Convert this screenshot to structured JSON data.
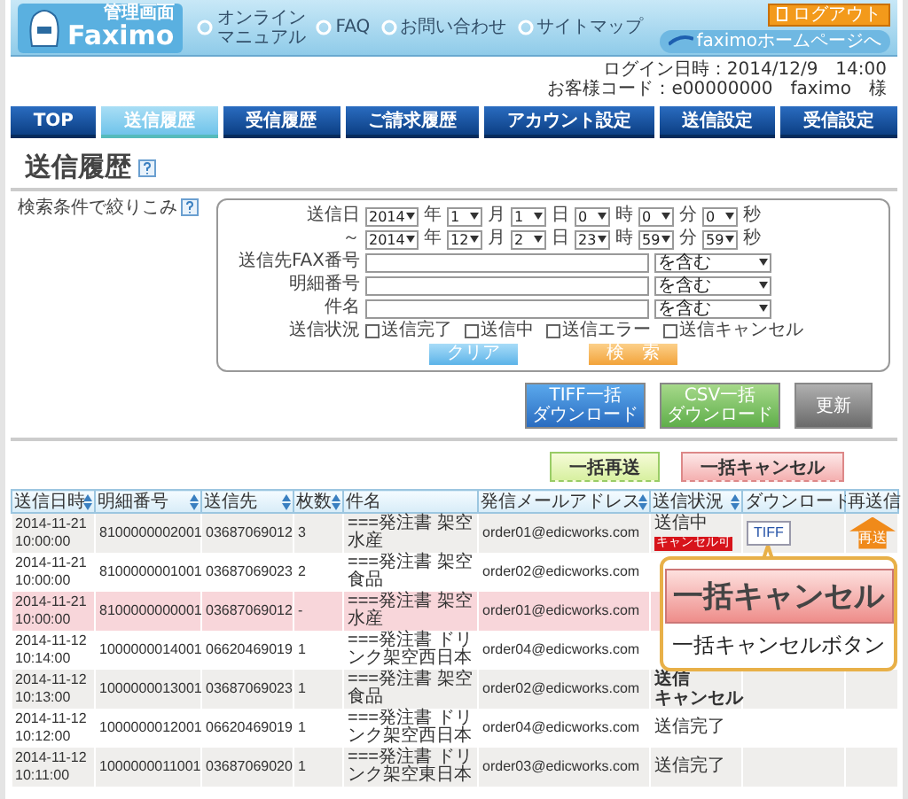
{
  "header": {
    "logo_text": "Faximo",
    "logo_caption": "管理画面",
    "links": [
      {
        "label_lines": [
          "オンライン",
          "マニュアル"
        ]
      },
      {
        "label_lines": [
          "FAQ"
        ]
      },
      {
        "label_lines": [
          "お問い合わせ"
        ]
      },
      {
        "label_lines": [
          "サイトマップ"
        ]
      }
    ],
    "homepage_link": "faximoホームページへ",
    "logout": "ログアウト"
  },
  "login": [
    "ログイン日時：2014/12/9　14:00",
    "お客様コード：e00000000　faximo　様"
  ],
  "nav": [
    {
      "label": "TOP",
      "selected": false
    },
    {
      "label": "送信履歴",
      "selected": true
    },
    {
      "label": "受信履歴",
      "selected": false
    },
    {
      "label": "ご請求履歴",
      "selected": false
    },
    {
      "label": "アカウント設定",
      "selected": false
    },
    {
      "label": "送信設定",
      "selected": false
    },
    {
      "label": "受信設定",
      "selected": false
    }
  ],
  "page_title": "送信履歴",
  "search": {
    "label": "検索条件で絞りこみ",
    "date_rows": [
      {
        "label": "送信日",
        "values": [
          "2014",
          "1",
          "1",
          "0",
          "0",
          "0"
        ],
        "units": [
          "年",
          "月",
          "日",
          "時",
          "分",
          "秒"
        ]
      },
      {
        "label": "～",
        "values": [
          "2014",
          "12",
          "2",
          "23",
          "59",
          "59"
        ],
        "units": [
          "年",
          "月",
          "日",
          "時",
          "分",
          "秒"
        ]
      }
    ],
    "text_fields": [
      {
        "label": "送信先FAX番号",
        "match": "を含む"
      },
      {
        "label": "明細番号",
        "match": "を含む"
      },
      {
        "label": "件名",
        "match": "を含む"
      }
    ],
    "status": {
      "label": "送信状況",
      "options": [
        {
          "label": "送信完了",
          "checked": false
        },
        {
          "label": "送信中",
          "checked": false
        },
        {
          "label": "送信エラー",
          "checked": false
        },
        {
          "label": "送信キャンセル",
          "checked": false
        }
      ]
    },
    "clear_button": "クリア",
    "search_button": "検　索"
  },
  "downloads": [
    {
      "kind": "tiff",
      "label_lines": [
        "TIFF一括",
        "ダウンロード"
      ]
    },
    {
      "kind": "csv",
      "label_lines": [
        "CSV一括",
        "ダウンロード"
      ]
    },
    {
      "kind": "refresh",
      "label_lines": [
        "更新"
      ]
    }
  ],
  "bulk_actions": [
    {
      "kind": "resend",
      "label": "一括再送"
    },
    {
      "kind": "cancel",
      "label": "一括キャンセル"
    }
  ],
  "table": {
    "columns": [
      {
        "label": "送信日時",
        "sortable": true
      },
      {
        "label": "明細番号",
        "sortable": true
      },
      {
        "label": "送信先",
        "sortable": true
      },
      {
        "label": "枚数",
        "sortable": true
      },
      {
        "label": "件名",
        "sortable": false
      },
      {
        "label": "発信メールアドレス",
        "sortable": true
      },
      {
        "label": "送信状況",
        "sortable": true
      },
      {
        "label": "ダウンロード",
        "sortable": false
      },
      {
        "label": "再送信",
        "sortable": false
      }
    ],
    "rows": [
      {
        "date": "2014-11-21",
        "time": "10:00:00",
        "detail_no": "8100000002001",
        "destination": "03687069012",
        "pages": "3",
        "subject": "===発注書 架空水産",
        "email": "order01@edicworks.com",
        "highlighted": false,
        "status_lines": [
          "送信中"
        ],
        "status_bold": false,
        "badge": "キャンセル可",
        "download": "TIFF",
        "resend": "再送"
      },
      {
        "date": "2014-11-21",
        "time": "10:00:00",
        "detail_no": "8100000001001",
        "destination": "03687069023",
        "pages": "2",
        "subject": "===発注書 架空食品",
        "email": "order02@edicworks.com",
        "highlighted": false
      },
      {
        "date": "2014-11-21",
        "time": "10:00:00",
        "detail_no": "8100000000001",
        "destination": "03687069012",
        "pages": "-",
        "subject": "===発注書 架空水産",
        "email": "order01@edicworks.com",
        "highlighted": true
      },
      {
        "date": "2014-11-12",
        "time": "10:14:00",
        "detail_no": "1000000014001",
        "destination": "06620469019",
        "pages": "1",
        "subject": "===発注書 ドリンク架空西日本",
        "email": "order04@edicworks.com",
        "highlighted": false
      },
      {
        "date": "2014-11-12",
        "time": "10:13:00",
        "detail_no": "1000000013001",
        "destination": "03687069023",
        "pages": "1",
        "subject": "===発注書 架空食品",
        "email": "order02@edicworks.com",
        "highlighted": false,
        "status_lines": [
          "送信",
          "キャンセル"
        ],
        "status_bold": true
      },
      {
        "date": "2014-11-12",
        "time": "10:12:00",
        "detail_no": "1000000012001",
        "destination": "06620469019",
        "pages": "1",
        "subject": "===発注書 ドリンク架空西日本",
        "email": "order04@edicworks.com",
        "highlighted": false,
        "status_lines": [
          "送信完了"
        ],
        "status_bold": false
      },
      {
        "date": "2014-11-12",
        "time": "10:11:00",
        "detail_no": "1000000011001",
        "destination": "03687069020",
        "pages": "1",
        "subject": "===発注書 ドリンク架空東日本",
        "email": "order03@edicworks.com",
        "highlighted": false,
        "status_lines": [
          "送信完了"
        ],
        "status_bold": false
      }
    ]
  },
  "callout": {
    "button": "一括キャンセル",
    "caption": "一括キャンセルボタン"
  }
}
